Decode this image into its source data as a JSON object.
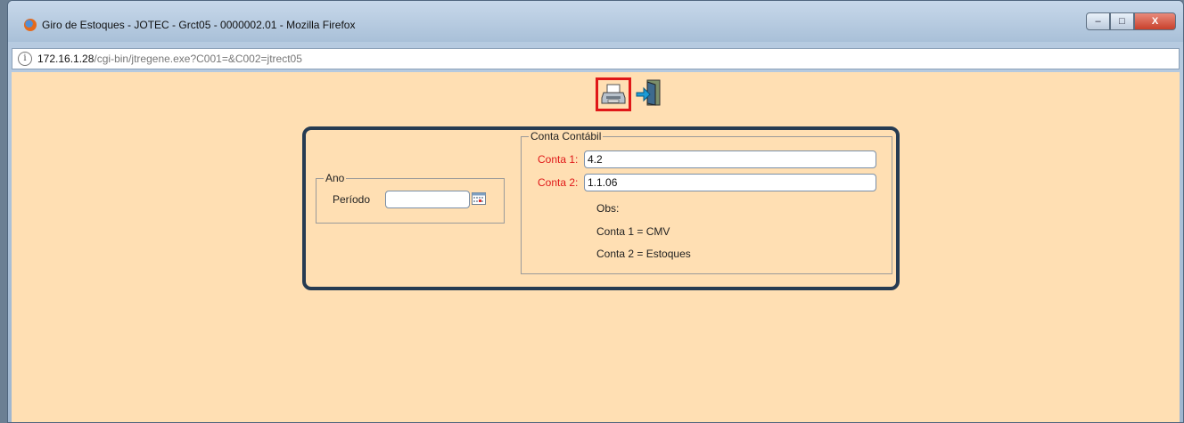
{
  "window": {
    "title": "Giro de Estoques - JOTEC - Grct05 - 0000002.01 - Mozilla Firefox",
    "controls": {
      "minimize": "–",
      "maximize": "□",
      "close": "X"
    }
  },
  "urlbar": {
    "info_glyph": "i",
    "host": "172.16.1.28",
    "path": "/cgi-bin/jtregene.exe?C001=&C002=jtrect05"
  },
  "toolbar": {
    "print_icon": "printer-icon",
    "exit_icon": "exit-door-icon"
  },
  "ano": {
    "legend": "Ano",
    "periodo_label": "Período",
    "periodo_value": ""
  },
  "conta_contabil": {
    "legend": "Conta Contábil",
    "conta1_label": "Conta 1:",
    "conta1_value": "4.2",
    "conta2_label": "Conta 2:",
    "conta2_value": "1.1.06",
    "obs_label": "Obs:",
    "obs_line1": "Conta 1 = CMV",
    "obs_line2": "Conta 2 = Estoques"
  },
  "colors": {
    "background": "#ffdfb3",
    "panel_border": "#263b52",
    "highlight": "#e01818",
    "required_label": "#e01818"
  }
}
